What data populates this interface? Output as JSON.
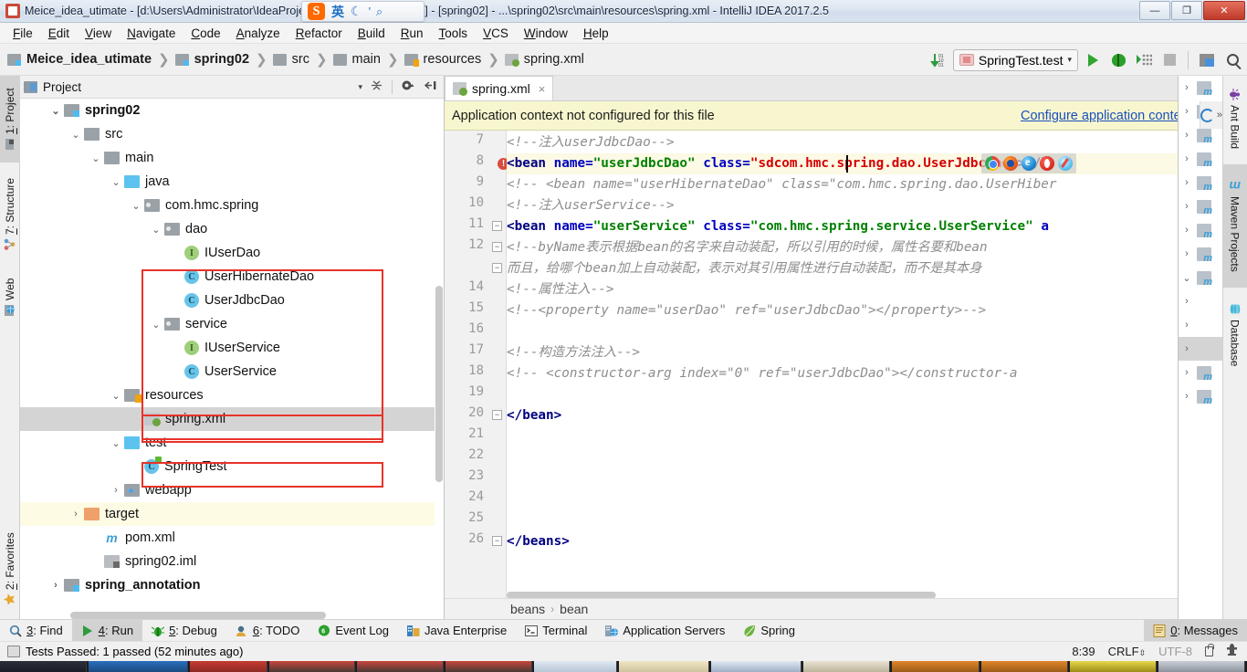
{
  "window": {
    "title": "Meice_idea_utimate - [d:\\Users\\Administrator\\IdeaProjects\\Meice_idea_utimate] - [spring02] - ...\\spring02\\src\\main\\resources\\spring.xml - IntelliJ IDEA 2017.2.5",
    "minimize": "—",
    "maximize": "❐",
    "close": "✕"
  },
  "ime": {
    "sogou": "S",
    "mode": "英",
    "moon": "☾",
    "dot": "'",
    "search": "⌕"
  },
  "menu": [
    "File",
    "Edit",
    "View",
    "Navigate",
    "Code",
    "Analyze",
    "Refactor",
    "Build",
    "Run",
    "Tools",
    "VCS",
    "Window",
    "Help"
  ],
  "breadcrumb": [
    {
      "label": "Meice_idea_utimate",
      "icon": "module-icon",
      "bold": true
    },
    {
      "label": "spring02",
      "icon": "module-icon",
      "bold": true
    },
    {
      "label": "src",
      "icon": "folder-icon",
      "bold": false
    },
    {
      "label": "main",
      "icon": "folder-icon",
      "bold": false
    },
    {
      "label": "resources",
      "icon": "resources-folder-icon",
      "bold": false
    },
    {
      "label": "spring.xml",
      "icon": "xml-file-icon",
      "bold": false
    }
  ],
  "toolbar": {
    "run_config": "SpringTest.test",
    "run_label": "▶",
    "debug_label": "debug-icon",
    "coverage_label": "coverage-icon",
    "stop_label": "stop-icon",
    "search_label": "search-icon"
  },
  "left_tool_tabs": [
    {
      "label": "1: Project",
      "num": "1",
      "rest": ": Project",
      "active": true,
      "icon": "project-icon"
    },
    {
      "label": "7: Structure",
      "num": "7",
      "rest": ": Structure",
      "active": false,
      "icon": "structure-icon"
    },
    {
      "label": "Web",
      "num": "",
      "rest": "Web",
      "active": false,
      "icon": "web-icon"
    },
    {
      "label": "2: Favorites",
      "num": "2",
      "rest": ": Favorites",
      "active": false,
      "icon": "star-icon"
    }
  ],
  "right_tool_tabs": [
    {
      "label": "Ant Build",
      "active": false,
      "icon": "ant-icon"
    },
    {
      "label": "Maven Projects",
      "active": true,
      "icon": "maven-icon"
    },
    {
      "label": "Database",
      "active": false,
      "icon": "database-icon"
    }
  ],
  "project_panel": {
    "title": "Project",
    "caret": "▾",
    "tree": [
      {
        "indent": 1,
        "arrow": "▾",
        "label": "spring02",
        "icon": "module-icon",
        "bold": true,
        "state": ""
      },
      {
        "indent": 2,
        "arrow": "▾",
        "label": "src",
        "icon": "folder-icon",
        "bold": false,
        "state": ""
      },
      {
        "indent": 3,
        "arrow": "▾",
        "label": "main",
        "icon": "folder-icon",
        "bold": false,
        "state": ""
      },
      {
        "indent": 4,
        "arrow": "▾",
        "label": "java",
        "icon": "source-folder-icon",
        "bold": false,
        "state": ""
      },
      {
        "indent": 5,
        "arrow": "▾",
        "label": "com.hmc.spring",
        "icon": "package-icon",
        "bold": false,
        "state": ""
      },
      {
        "indent": 6,
        "arrow": "▾",
        "label": "dao",
        "icon": "package-icon",
        "bold": false,
        "state": ""
      },
      {
        "indent": 7,
        "arrow": "",
        "label": "IUserDao",
        "icon": "interface-icon",
        "badge": "I",
        "bold": false,
        "state": ""
      },
      {
        "indent": 7,
        "arrow": "",
        "label": "UserHibernateDao",
        "icon": "class-icon",
        "badge": "C",
        "bold": false,
        "state": ""
      },
      {
        "indent": 7,
        "arrow": "",
        "label": "UserJdbcDao",
        "icon": "class-icon",
        "badge": "C",
        "bold": false,
        "state": ""
      },
      {
        "indent": 6,
        "arrow": "▾",
        "label": "service",
        "icon": "package-icon",
        "bold": false,
        "state": ""
      },
      {
        "indent": 7,
        "arrow": "",
        "label": "IUserService",
        "icon": "interface-icon",
        "badge": "I",
        "bold": false,
        "state": ""
      },
      {
        "indent": 7,
        "arrow": "",
        "label": "UserService",
        "icon": "class-icon",
        "badge": "C",
        "bold": false,
        "state": ""
      },
      {
        "indent": 4,
        "arrow": "▾",
        "label": "resources",
        "icon": "resources-folder-icon",
        "bold": false,
        "state": ""
      },
      {
        "indent": 5,
        "arrow": "",
        "label": "spring.xml",
        "icon": "xml-file-icon",
        "bold": false,
        "state": "selected"
      },
      {
        "indent": 4,
        "arrow": "▾",
        "label": "test",
        "icon": "source-folder-icon",
        "bold": false,
        "state": ""
      },
      {
        "indent": 5,
        "arrow": "",
        "label": "SpringTest",
        "icon": "test-class-icon",
        "badge": "C",
        "bold": false,
        "state": ""
      },
      {
        "indent": 4,
        "arrow": "›",
        "label": "webapp",
        "icon": "web-folder-icon",
        "bold": false,
        "state": ""
      },
      {
        "indent": 2,
        "arrow": "›",
        "label": "target",
        "icon": "target-folder-icon",
        "bold": false,
        "state": "highlighted"
      },
      {
        "indent": 3,
        "arrow": "",
        "label": "pom.xml",
        "icon": "maven-pom-icon",
        "bold": false,
        "state": ""
      },
      {
        "indent": 3,
        "arrow": "",
        "label": "spring02.iml",
        "icon": "iml-file-icon",
        "bold": false,
        "state": ""
      },
      {
        "indent": 1,
        "arrow": "›",
        "label": "spring_annotation",
        "icon": "module-icon",
        "bold": true,
        "state": ""
      }
    ]
  },
  "editor": {
    "tab": {
      "label": "spring.xml",
      "close": "×"
    },
    "notification": {
      "message": "Application context not configured for this file",
      "link": "Configure application context",
      "gear": "⚙"
    },
    "lines": [
      {
        "n": "7",
        "segments": [
          {
            "t": "    ",
            "c": "plain"
          },
          {
            "t": "<!--注入userJdbcDao-->",
            "c": "cm"
          }
        ]
      },
      {
        "n": "8",
        "segments": [
          {
            "t": "    <bean ",
            "c": "tagb"
          },
          {
            "t": "name=",
            "c": "attr"
          },
          {
            "t": "\"userJdbcDao\"",
            "c": "val"
          },
          {
            "t": " class=",
            "c": "attr"
          },
          {
            "t": "\"sdcom.hmc.spring.dao.UserJdbcDao\"",
            "c": "valr"
          },
          {
            "t": "></b",
            "c": "tagb"
          }
        ]
      },
      {
        "n": "9",
        "segments": [
          {
            "t": "  <!--  <bean name=\"userHibernateDao\" class=\"com.hmc.spring.dao.UserHiber",
            "c": "cm"
          }
        ]
      },
      {
        "n": "10",
        "segments": [
          {
            "t": "    ",
            "c": "plain"
          },
          {
            "t": "<!--注入userService-->",
            "c": "cm"
          }
        ]
      },
      {
        "n": "11",
        "segments": [
          {
            "t": "    <bean ",
            "c": "tagb"
          },
          {
            "t": "name=",
            "c": "attr"
          },
          {
            "t": "\"userService\"",
            "c": "val"
          },
          {
            "t": " class=",
            "c": "attr"
          },
          {
            "t": "\"com.hmc.spring.service.UserService\"",
            "c": "val"
          },
          {
            "t": " a",
            "c": "attr"
          }
        ]
      },
      {
        "n": "12",
        "segments": [
          {
            "t": "      <!--byName表示根据bean的名字来自动装配，所以引用的时候，属性名要和bean",
            "c": "cm"
          }
        ]
      },
      {
        "n": "",
        "segments": [
          {
            "t": "      而且，给哪个bean加上自动装配，表示对其引用属性进行自动装配，而不是其本身",
            "c": "cm"
          }
        ]
      },
      {
        "n": "14",
        "segments": [
          {
            "t": "      <!--属性注入-->",
            "c": "cm"
          }
        ]
      },
      {
        "n": "15",
        "segments": [
          {
            "t": "      <!--<property name=\"userDao\" ref=\"userJdbcDao\"></property>-->",
            "c": "cm"
          }
        ]
      },
      {
        "n": "16",
        "segments": []
      },
      {
        "n": "17",
        "segments": [
          {
            "t": "      <!--构造方法注入-->",
            "c": "cm"
          }
        ]
      },
      {
        "n": "18",
        "segments": [
          {
            "t": "      <!-- <constructor-arg index=\"0\" ref=\"userJdbcDao\"></constructor-a",
            "c": "cm"
          }
        ]
      },
      {
        "n": "19",
        "segments": []
      },
      {
        "n": "20",
        "segments": [
          {
            "t": "    </bean>",
            "c": "tagb"
          }
        ]
      },
      {
        "n": "21",
        "segments": []
      },
      {
        "n": "22",
        "segments": []
      },
      {
        "n": "23",
        "segments": []
      },
      {
        "n": "24",
        "segments": []
      },
      {
        "n": "25",
        "segments": []
      },
      {
        "n": "26",
        "segments": [
          {
            "t": "  </beans>",
            "c": "tagb"
          }
        ]
      }
    ],
    "browser_popup": [
      "chrome-icon",
      "firefox-icon",
      "ie-icon",
      "opera-icon",
      "safari-icon"
    ],
    "breadcrumb": [
      "beans",
      "bean"
    ],
    "breadcrumb_sep": "›"
  },
  "bottom_tabs": [
    {
      "label": "3: Find",
      "num": "3",
      "rest": ": Find",
      "icon": "find-icon",
      "active": false
    },
    {
      "label": "4: Run",
      "num": "4",
      "rest": ": Run",
      "icon": "run-icon",
      "active": true
    },
    {
      "label": "5: Debug",
      "num": "5",
      "rest": ": Debug",
      "icon": "debug-icon",
      "active": false
    },
    {
      "label": "6: TODO",
      "num": "6",
      "rest": ": TODO",
      "icon": "todo-icon",
      "active": false
    },
    {
      "label": "Event Log",
      "num": "",
      "rest": "Event Log",
      "icon": "event-log-icon",
      "active": false
    },
    {
      "label": "Java Enterprise",
      "num": "",
      "rest": "Java Enterprise",
      "icon": "java-enterprise-icon",
      "active": false
    },
    {
      "label": "Terminal",
      "num": "",
      "rest": "Terminal",
      "icon": "terminal-icon",
      "active": false
    },
    {
      "label": "Application Servers",
      "num": "",
      "rest": "Application Servers",
      "icon": "app-servers-icon",
      "active": false
    },
    {
      "label": "Spring",
      "num": "",
      "rest": "Spring",
      "icon": "spring-leaf-icon",
      "active": false
    },
    {
      "label": "0: Messages",
      "num": "0",
      "rest": ": Messages",
      "icon": "messages-icon",
      "active": true
    }
  ],
  "status": {
    "message": "Tests Passed: 1 passed (52 minutes ago)",
    "position": "8:39",
    "line_separator": "CRLF",
    "encoding": "UTF-8",
    "lock": "lock-icon",
    "hydrant": "hydrant-icon"
  },
  "colors": {
    "accent_red": "#e8332a",
    "link_blue": "#1a4fbf",
    "notification_bg": "#f7f6cf",
    "tag_blue": "#000080",
    "string_green": "#008000",
    "string_red": "#d40000",
    "comment_gray": "#8d8d8d"
  }
}
